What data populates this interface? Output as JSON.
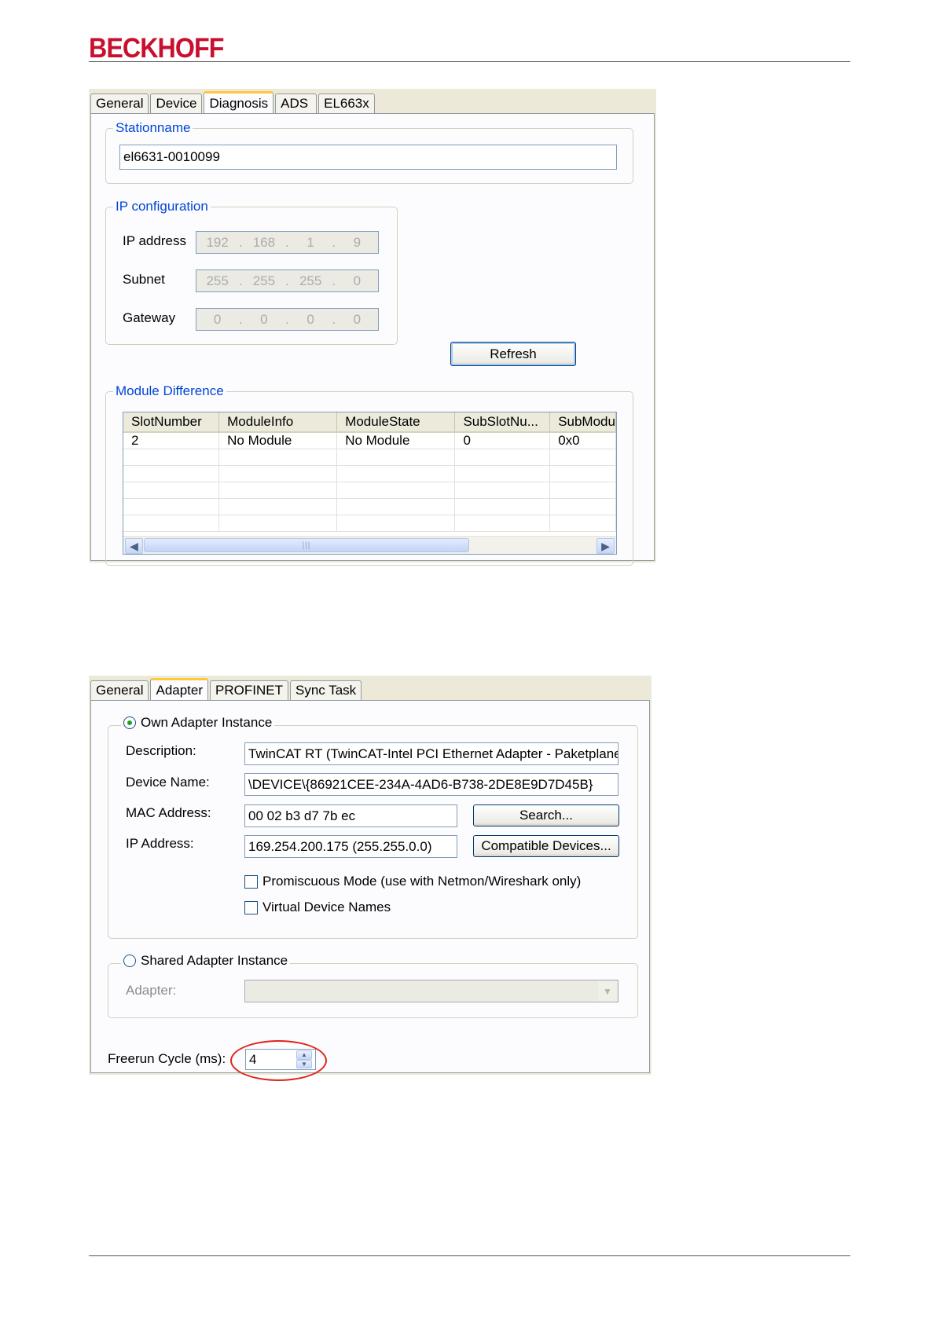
{
  "header": {
    "logo": "BECKHOFF"
  },
  "diag": {
    "tabs": [
      "General",
      "Device",
      "Diagnosis",
      "ADS",
      "EL663x"
    ],
    "station": {
      "legend": "Stationname",
      "value": "el6631-0010099"
    },
    "ip": {
      "legend": "IP configuration",
      "address_label": "IP address",
      "address": [
        "192",
        "168",
        "1",
        "9"
      ],
      "subnet_label": "Subnet",
      "subnet": [
        "255",
        "255",
        "255",
        "0"
      ],
      "gateway_label": "Gateway",
      "gateway": [
        "0",
        "0",
        "0",
        "0"
      ]
    },
    "refresh_label": "Refresh",
    "module": {
      "legend": "Module Difference",
      "columns": [
        "SlotNumber",
        "ModuleInfo",
        "ModuleState",
        "SubSlotNu...",
        "SubModu"
      ],
      "rows": [
        [
          "2",
          "No Module",
          "No Module",
          "0",
          "0x0"
        ]
      ],
      "scroll_thumb": "|||"
    }
  },
  "adapter": {
    "tabs": [
      "General",
      "Adapter",
      "PROFINET",
      "Sync Task"
    ],
    "own": {
      "legend": "Own Adapter Instance",
      "description_label": "Description:",
      "description": "TwinCAT RT (TwinCAT-Intel PCI Ethernet Adapter - Paketplaner-I",
      "device_label": "Device Name:",
      "device": "\\DEVICE\\{86921CEE-234A-4AD6-B738-2DE8E9D7D45B}",
      "mac_label": "MAC Address:",
      "mac": "00 02 b3 d7 7b ec",
      "ip_label": "IP Address:",
      "ip": "169.254.200.175 (255.255.0.0)",
      "search_label": "Search...",
      "compatible_label": "Compatible Devices...",
      "promiscuous_label": "Promiscuous Mode (use with Netmon/Wireshark only)",
      "virtual_label": "Virtual Device Names"
    },
    "shared": {
      "legend": "Shared Adapter Instance",
      "adapter_label": "Adapter:"
    },
    "freerun": {
      "label": "Freerun Cycle (ms):",
      "value": "4"
    }
  }
}
